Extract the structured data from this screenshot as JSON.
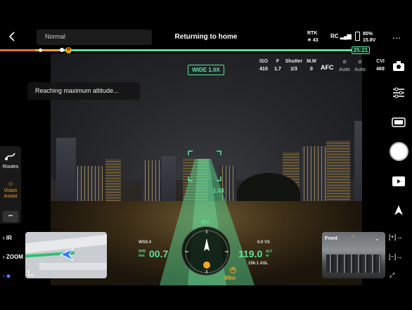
{
  "topbar": {
    "mode": "Normal",
    "status": "Returning to home",
    "rtk_label": "RTK",
    "rtk_value": "43",
    "rc_label": "RC",
    "battery_percent": "85%",
    "battery_voltage": "15.8V",
    "flight_timer": "25:21"
  },
  "camera": {
    "zoom_tag": "WIDE 1.0X",
    "params": [
      {
        "key": "ISO",
        "value": "410"
      },
      {
        "key": "F",
        "value": "1.7"
      },
      {
        "key": "Shutter",
        "value": "1/3"
      },
      {
        "key": "M.M",
        "value": "0"
      }
    ],
    "focus": "AFC",
    "auto1": "Auto",
    "auto2": "Auto",
    "cvi_label": "CVI",
    "cvi_value": "469"
  },
  "toast": "Reaching maximum altitude...",
  "left_sidebar": {
    "routes": "Routes",
    "vision_assist_line1": "Vision",
    "vision_assist_line2": "Assist",
    "more": "•••",
    "ir": "IR",
    "zoom": "ZOOM"
  },
  "front_view": {
    "label": "Front"
  },
  "hud": {
    "heading": "257",
    "distance_marker": "1.0X",
    "wind": "WS0.4",
    "speed_label": "SPD",
    "speed_unit": "m/s",
    "speed": "00.7",
    "alt_label": "ALT",
    "alt_unit": "m",
    "altitude": "119.0",
    "vs": "0.0 VS",
    "asl": "156.1 ASL",
    "home_distance": "99m",
    "home_marker": "H"
  },
  "colors": {
    "accent": "#5be39a",
    "warning": "#f5a623",
    "route_orange": "#e3703a"
  }
}
